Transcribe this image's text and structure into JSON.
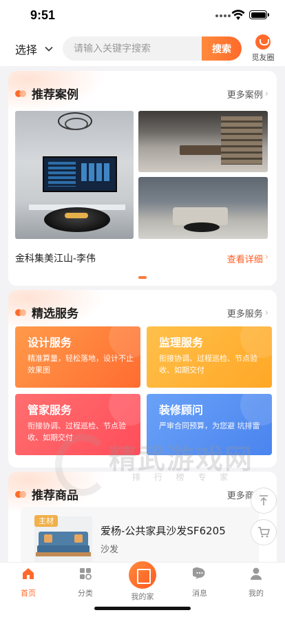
{
  "status_bar": {
    "time": "9:51"
  },
  "nav": {
    "select_label": "选择",
    "search_placeholder": "请输入关键字搜索",
    "search_button": "搜索",
    "friends_label": "觅友圈"
  },
  "cases": {
    "title": "推荐案例",
    "more": "更多案例",
    "name": "金科集美江山-李伟",
    "detail": "查看详细"
  },
  "services": {
    "title": "精选服务",
    "more": "更多服务",
    "items": [
      {
        "title": "设计服务",
        "desc": "精准算量，轻松落地，设计不止效果图",
        "color": "#ff7a36"
      },
      {
        "title": "监理服务",
        "desc": "衔接协调、过程巡检、节点验收、如期交付",
        "color": "#ffb234"
      },
      {
        "title": "管家服务",
        "desc": "衔接协调、过程巡检、节点验收、如期交付",
        "color": "#ff5a62"
      },
      {
        "title": "装修顾问",
        "desc": "严审合同预算，为您避 坑排雷",
        "color": "#5a93f2"
      }
    ]
  },
  "products": {
    "title": "推荐商品",
    "more": "更多商品",
    "tag": "主材",
    "name": "爱杨-公共家具沙发SF6205",
    "category": "沙发"
  },
  "watermark": {
    "text": "精武游戏网",
    "sub": "排 行 榜 专 家"
  },
  "tabs": [
    {
      "label": "首页",
      "icon": "home-icon",
      "active": true
    },
    {
      "label": "分类",
      "icon": "category-icon",
      "active": false
    },
    {
      "label": "我的家",
      "icon": "my-home-icon",
      "active": false
    },
    {
      "label": "消息",
      "icon": "message-icon",
      "active": false
    },
    {
      "label": "我的",
      "icon": "profile-icon",
      "active": false
    }
  ],
  "colors": {
    "accent": "#ff6a2a",
    "accent_light": "#ff8a3d"
  }
}
